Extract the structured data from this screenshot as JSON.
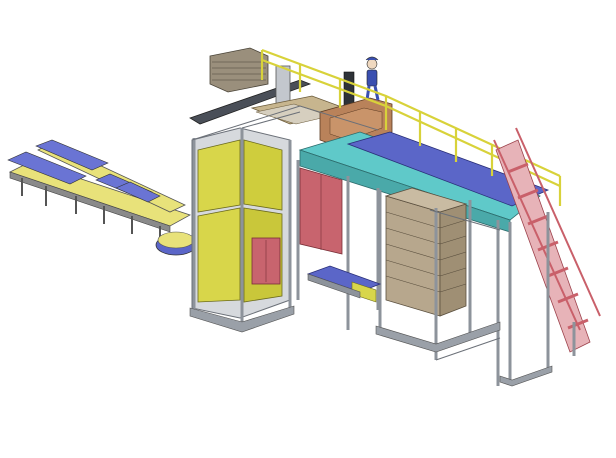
{
  "scene": {
    "kind": "isometric CAD rendering of an automated palletizing line",
    "colors": {
      "background": "#ffffff",
      "frame": "#b8bdc4",
      "frame_dark": "#7d838c",
      "cabinet_yellow": "#d8d64a",
      "cabinet_yellow_dark": "#a9a72c",
      "panel_red": "#c8646e",
      "panel_red_dark": "#9c414b",
      "conveyor_blue": "#5b66c8",
      "conveyor_teal": "#5fc9c9",
      "railing_yellow": "#d8d23a",
      "stairs_red": "#c9606a",
      "pallet_wood": "#b7a78d",
      "pallet_wood_dark": "#8e7f66",
      "infeed_yellow": "#e8e27a",
      "infeed_blue": "#6a74d4",
      "operator_blue": "#3a4fb0"
    },
    "icons": [
      "robot-figure-icon"
    ]
  }
}
